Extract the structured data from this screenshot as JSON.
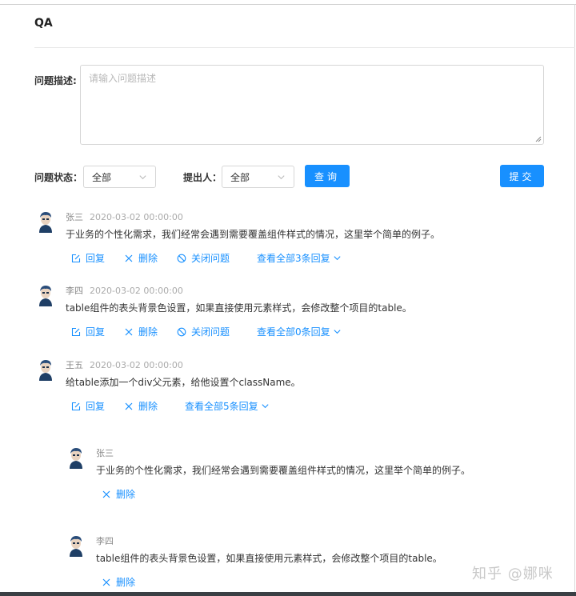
{
  "page": {
    "title": "QA"
  },
  "form": {
    "desc_label": "问题描述:",
    "desc_placeholder": "请输入问题描述",
    "status_label": "问题状态：",
    "status_value": "全部",
    "proposer_label": "提出人：",
    "proposer_value": "全部",
    "query_button": "查询",
    "submit_button": "提交"
  },
  "questions": [
    {
      "name": "张三",
      "time": "2020-03-02 00:00:00",
      "content": "于业务的个性化需求，我们经常会遇到需要覆盖组件样式的情况，这里举个简单的例子。",
      "reply": "回复",
      "delete": "删除",
      "close": "关闭问题",
      "view_replies": "查看全部3条回复"
    },
    {
      "name": "李四",
      "time": "2020-03-02 00:00:00",
      "content": "table组件的表头背景色设置，如果直接使用元素样式，会修改整个项目的table。",
      "reply": "回复",
      "delete": "删除",
      "close": "关闭问题",
      "view_replies": "查看全部0条回复"
    },
    {
      "name": "王五",
      "time": "2020-03-02 00:00:00",
      "content": "给table添加一个div父元素，给他设置个className。",
      "reply": "回复",
      "delete": "删除",
      "view_replies": "查看全部5条回复"
    }
  ],
  "replies": [
    {
      "name": "张三",
      "content": "于业务的个性化需求，我们经常会遇到需要覆盖组件样式的情况，这里举个简单的例子。",
      "delete": "删除"
    },
    {
      "name": "李四",
      "content": "table组件的表头背景色设置，如果直接使用元素样式，会修改整个项目的table。",
      "delete": "删除"
    }
  ],
  "watermark": "知乎 @娜咪",
  "colors": {
    "accent": "#1890ff",
    "text": "#333333",
    "muted": "#999999",
    "border": "#d6d6d6"
  }
}
